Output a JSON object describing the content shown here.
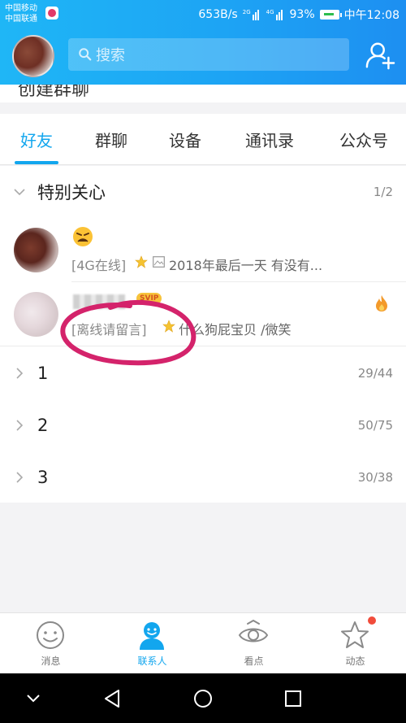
{
  "status_bar": {
    "carrier1": "中国移动",
    "carrier2": "中国联通",
    "net_speed": "653B/s",
    "sig1_tag": "2G",
    "sig2_tag": "4G",
    "battery": "93%",
    "time": "中午12:08"
  },
  "header": {
    "search_placeholder": "搜索",
    "partial_row_text": "创建群聊"
  },
  "tabs": [
    {
      "label": "好友",
      "active": true
    },
    {
      "label": "群聊"
    },
    {
      "label": "设备"
    },
    {
      "label": "通讯录"
    },
    {
      "label": "公众号"
    }
  ],
  "groups": {
    "special": {
      "name": "特别关心",
      "count": "1/2"
    },
    "g1": {
      "name": "1",
      "count": "29/44"
    },
    "g2": {
      "name": "2",
      "count": "50/75"
    },
    "g3": {
      "name": "3",
      "count": "30/38"
    }
  },
  "contacts": [
    {
      "status": "[4G在线]",
      "message": "2018年最后一天 有没有..."
    },
    {
      "badge": "SVIP",
      "status": "[离线请留言]",
      "message": "什么狗屁宝贝 /微笑"
    }
  ],
  "bottom_nav": [
    {
      "label": "消息",
      "icon": "smile-icon"
    },
    {
      "label": "联系人",
      "icon": "contacts-icon",
      "active": true
    },
    {
      "label": "看点",
      "icon": "eye-icon"
    },
    {
      "label": "动态",
      "icon": "star-icon"
    }
  ],
  "colors": {
    "accent": "#12a6ee",
    "header_gradient_start": "#1fb6f6",
    "header_gradient_end": "#1d8ff1",
    "annotation": "#d4236b",
    "notification_dot": "#f14c3b"
  }
}
